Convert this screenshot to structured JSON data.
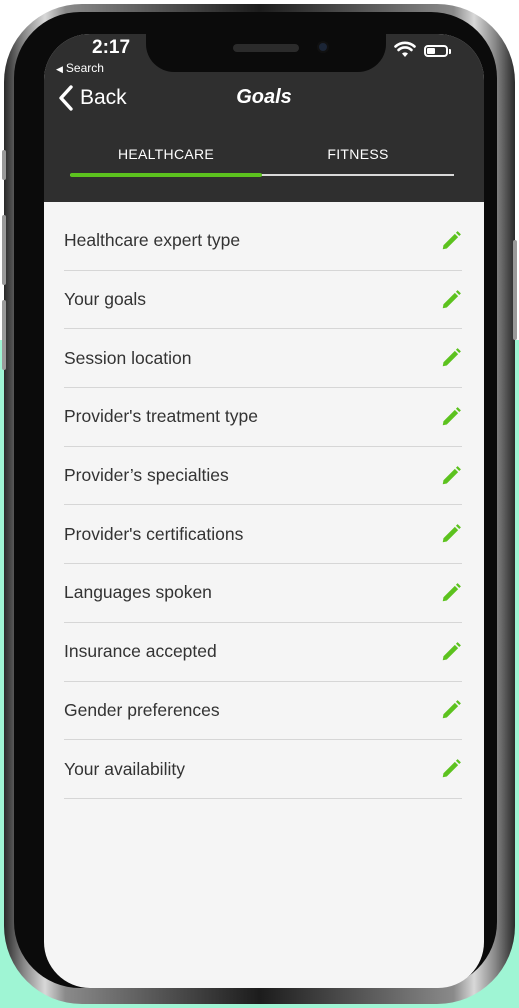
{
  "status_bar": {
    "time": "2:17",
    "back_to_app": "Search"
  },
  "header": {
    "back_label": "Back",
    "title": "Goals"
  },
  "tabs": [
    {
      "label": "HEALTHCARE",
      "active": true
    },
    {
      "label": "FITNESS",
      "active": false
    }
  ],
  "items": [
    {
      "label": "Healthcare expert type",
      "icon": "pencil-icon"
    },
    {
      "label": "Your goals",
      "icon": "pencil-icon"
    },
    {
      "label": "Session location",
      "icon": "pencil-icon"
    },
    {
      "label": "Provider's treatment type",
      "icon": "pencil-icon"
    },
    {
      "label": "Provider’s specialties",
      "icon": "pencil-icon"
    },
    {
      "label": "Provider's certifications",
      "icon": "pencil-icon"
    },
    {
      "label": "Languages spoken",
      "icon": "pencil-icon"
    },
    {
      "label": "Insurance accepted",
      "icon": "pencil-icon"
    },
    {
      "label": "Gender preferences",
      "icon": "pencil-icon"
    },
    {
      "label": "Your availability",
      "icon": "pencil-icon"
    }
  ],
  "colors": {
    "header_bg": "#2f2f2f",
    "accent_green": "#5cc21e",
    "screen_bg": "#f5f5f5",
    "mint_background": "#9ff5d4"
  }
}
